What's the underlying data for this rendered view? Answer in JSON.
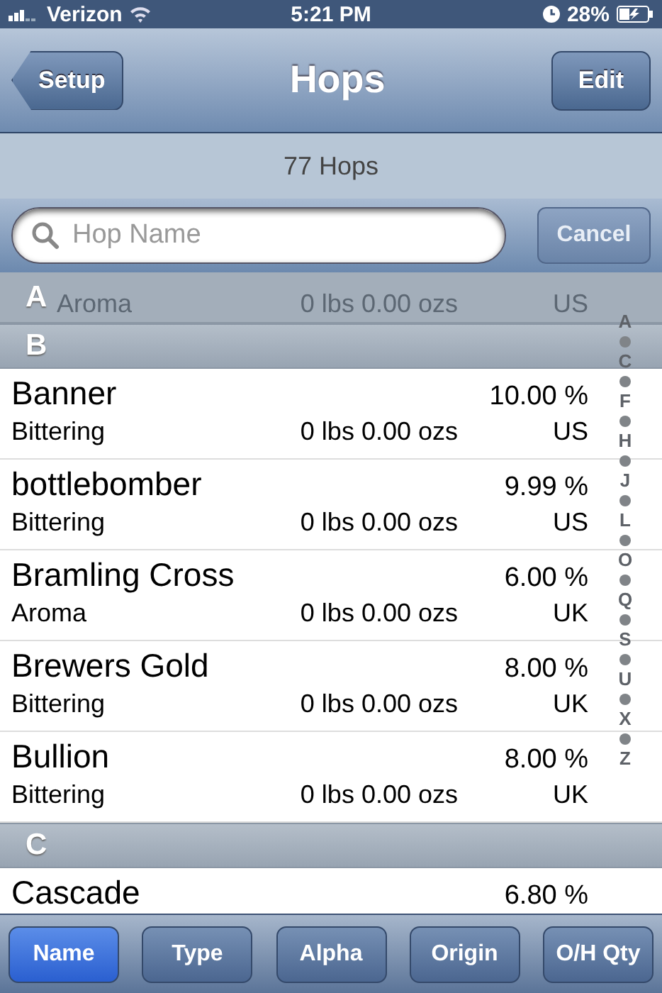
{
  "status_bar": {
    "carrier": "Verizon",
    "time": "5:21 PM",
    "battery": "28%"
  },
  "nav": {
    "back": "Setup",
    "title": "Hops",
    "action": "Edit"
  },
  "count": "77 Hops",
  "search": {
    "placeholder": "Hop Name",
    "cancel": "Cancel"
  },
  "sticky_header": "A",
  "partial_top_row": {
    "type": "Aroma",
    "quantity": "0 lbs 0.00 ozs",
    "origin": "US"
  },
  "sections": [
    {
      "letter": "B",
      "rows": [
        {
          "name": "Banner",
          "type": "Bittering",
          "quantity": "0 lbs 0.00 ozs",
          "alpha": "10.00 %",
          "origin": "US"
        },
        {
          "name": "bottlebomber",
          "type": "Bittering",
          "quantity": "0 lbs 0.00 ozs",
          "alpha": "9.99 %",
          "origin": "US"
        },
        {
          "name": "Bramling Cross",
          "type": "Aroma",
          "quantity": "0 lbs 0.00 ozs",
          "alpha": "6.00 %",
          "origin": "UK"
        },
        {
          "name": "Brewers Gold",
          "type": "Bittering",
          "quantity": "0 lbs 0.00 ozs",
          "alpha": "8.00 %",
          "origin": "UK"
        },
        {
          "name": "Bullion",
          "type": "Bittering",
          "quantity": "0 lbs 0.00 ozs",
          "alpha": "8.00 %",
          "origin": "UK"
        }
      ]
    },
    {
      "letter": "C",
      "rows": [
        {
          "name": "Cascade",
          "alpha": "6.80 %"
        }
      ]
    }
  ],
  "index": [
    "A",
    "C",
    "F",
    "H",
    "J",
    "L",
    "O",
    "Q",
    "S",
    "U",
    "X",
    "Z"
  ],
  "sort_buttons": [
    {
      "label": "Name",
      "selected": true
    },
    {
      "label": "Type",
      "selected": false
    },
    {
      "label": "Alpha",
      "selected": false
    },
    {
      "label": "Origin",
      "selected": false
    },
    {
      "label": "O/H Qty",
      "selected": false
    }
  ]
}
